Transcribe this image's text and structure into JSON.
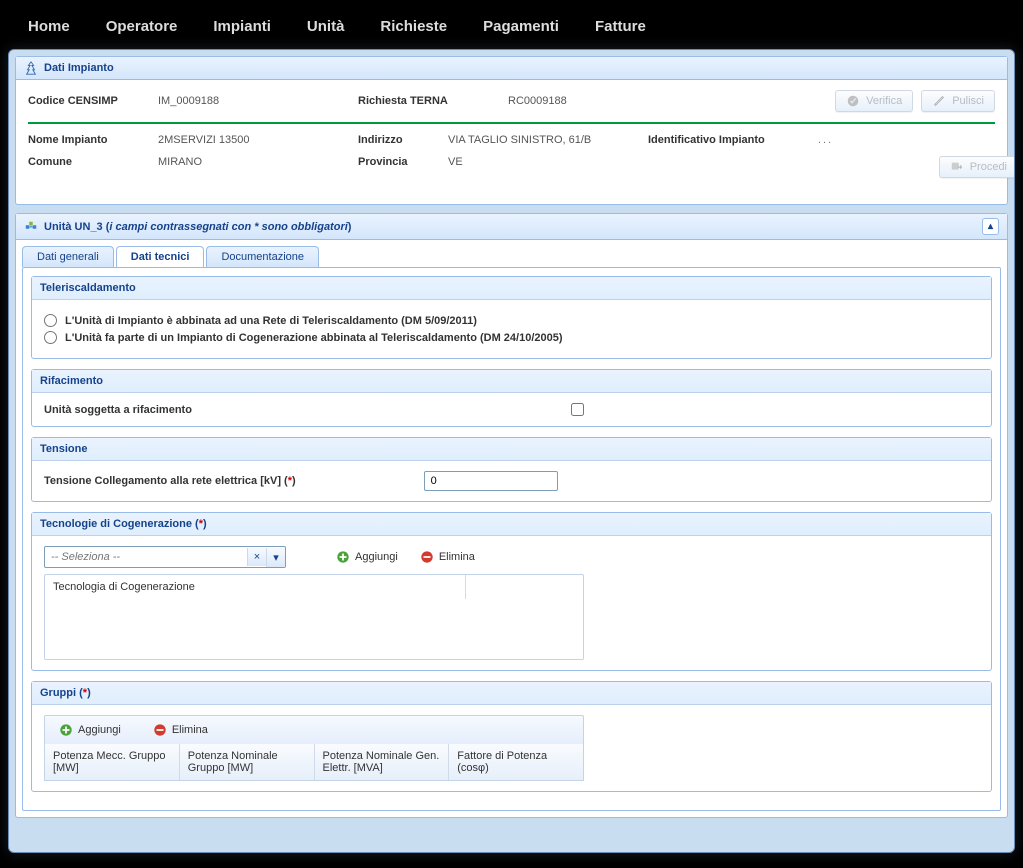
{
  "nav": [
    "Home",
    "Operatore",
    "Impianti",
    "Unità",
    "Richieste",
    "Pagamenti",
    "Fatture"
  ],
  "dati_impianto": {
    "title": "Dati Impianto",
    "codice_censimp_lbl": "Codice CENSIMP",
    "codice_censimp_val": "IM_0009188",
    "richiesta_terna_lbl": "Richiesta TERNA",
    "richiesta_terna_val": "RC0009188",
    "nome_impianto_lbl": "Nome Impianto",
    "nome_impianto_val": "2MSERVIZI 13500",
    "comune_lbl": "Comune",
    "comune_val": "MIRANO",
    "indirizzo_lbl": "Indirizzo",
    "indirizzo_val": "VIA TAGLIO SINISTRO, 61/B",
    "provincia_lbl": "Provincia",
    "provincia_val": "VE",
    "ident_impianto_lbl": "Identificativo Impianto",
    "ident_impianto_val": "...",
    "btn_verifica": "Verifica",
    "btn_pulisci": "Pulisci",
    "btn_procedi": "Procedi"
  },
  "unit_panel": {
    "title_prefix": "Unità UN_3 (",
    "title_italic": "i campi contrassegnati con * sono obbligatori",
    "title_suffix": ")",
    "tabs": {
      "generali": "Dati generali",
      "tecnici": "Dati tecnici",
      "doc": "Documentazione"
    }
  },
  "teleriscaldamento": {
    "title": "Teleriscaldamento",
    "opt1": "L'Unità di Impianto è abbinata ad una Rete di Teleriscaldamento (DM 5/09/2011)",
    "opt2": "L'Unità fa parte di un Impianto di Cogenerazione abbinata al Teleriscaldamento (DM 24/10/2005)"
  },
  "rifacimento": {
    "title": "Rifacimento",
    "label": "Unità soggetta a rifacimento"
  },
  "tensione": {
    "title": "Tensione",
    "label": "Tensione Collegamento alla rete elettrica [kV] (",
    "req": "*",
    "close": ")",
    "value": "0"
  },
  "tecnologie": {
    "title_pre": "Tecnologie di Cogenerazione (",
    "title_req": "*",
    "title_post": ")",
    "placeholder": "-- Seleziona --",
    "aggiungi": "Aggiungi",
    "elimina": "Elimina",
    "col": "Tecnologia di Cogenerazione"
  },
  "gruppi": {
    "title_pre": "Gruppi (",
    "title_req": "*",
    "title_post": ")",
    "aggiungi": "Aggiungi",
    "elimina": "Elimina",
    "cols": [
      "Potenza Mecc. Gruppo [MW]",
      "Potenza Nominale Gruppo [MW]",
      "Potenza Nominale Gen. Elettr. [MVA]",
      "Fattore di Potenza (cosφ)"
    ]
  }
}
